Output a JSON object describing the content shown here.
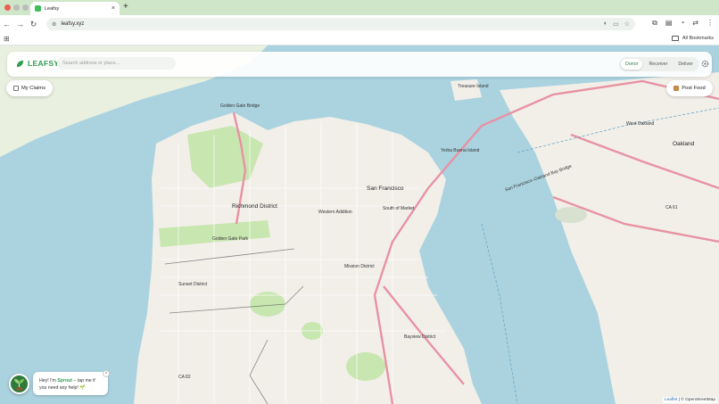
{
  "browser": {
    "tab_title": "Leafsy",
    "url": "leafsy.xyz",
    "bookmarks_label": "All Bookmarks"
  },
  "app": {
    "brand": "LEAFSY",
    "search_placeholder": "Search address or place...",
    "roles": [
      "Donor",
      "Receiver",
      "Deliver"
    ],
    "active_role": "Donor",
    "my_claims_label": "My Claims",
    "post_food_label": "Post Food"
  },
  "sprout": {
    "greeting_prefix": "Hey! I'm ",
    "name": "Sprout",
    "greeting_suffix": " – tap me if",
    "line2": "you need any help! 🌱",
    "close": "×"
  },
  "map": {
    "labels": {
      "golden_gate": "Golden Gate Bridge",
      "san_francisco": "San Francisco",
      "richmond": "Richmond District",
      "western_addition": "Western Addition",
      "south_of_market": "South of Market",
      "mission": "Mission District",
      "sunset": "Sunset District",
      "bayview": "Bayview District",
      "oakland": "Oakland",
      "west_oakland": "West Oakland",
      "yerba_buena": "Yerba Buena Island",
      "treasure_island": "Treasure Island",
      "golden_gate_park": "Golden Gate Park",
      "ca82": "CA 82",
      "ca61": "CA 61",
      "sf_bay_bridge": "San Francisco–Oakland Bay Bridge"
    },
    "attribution_leaflet": "Leaflet",
    "attribution_rest": " | © OpenStreetMap"
  },
  "colors": {
    "brand_green": "#2e9e4e",
    "water": "#aad3df",
    "land": "#f2efe9",
    "park": "#c8e6b0",
    "highway": "#e892a2"
  }
}
